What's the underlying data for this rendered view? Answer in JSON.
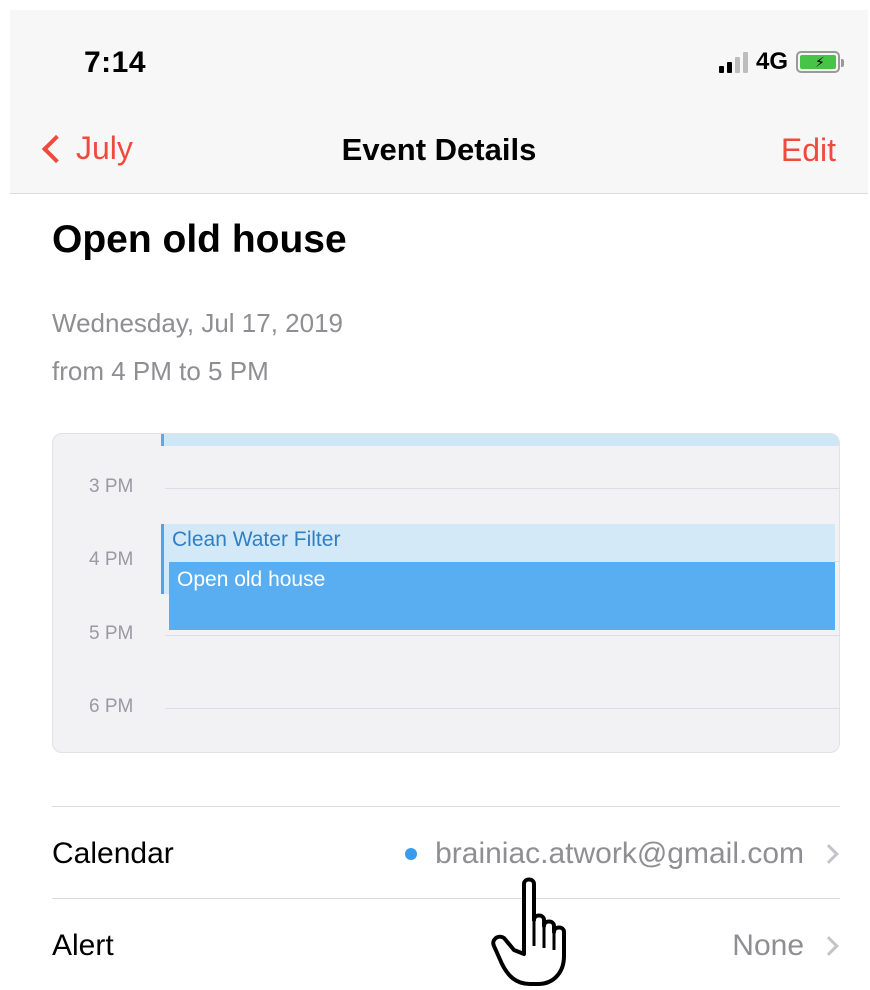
{
  "status_bar": {
    "time": "7:14",
    "network": "4G"
  },
  "nav": {
    "back_label": "July",
    "title": "Event Details",
    "edit_label": "Edit"
  },
  "event": {
    "title": "Open old house",
    "date": "Wednesday, Jul 17, 2019",
    "time_range": "from 4 PM to 5 PM"
  },
  "day_preview": {
    "hours": [
      "3 PM",
      "4 PM",
      "5 PM",
      "6 PM"
    ],
    "events": [
      "Clean Water Filter",
      "Open old house"
    ]
  },
  "rows": {
    "calendar": {
      "label": "Calendar",
      "value": "brainiac.atwork@gmail.com",
      "dot_color": "#3a9bea"
    },
    "alert": {
      "label": "Alert",
      "value": "None"
    }
  },
  "colors": {
    "accent": "#ef4a3c",
    "event_blue": "#58aef0"
  }
}
